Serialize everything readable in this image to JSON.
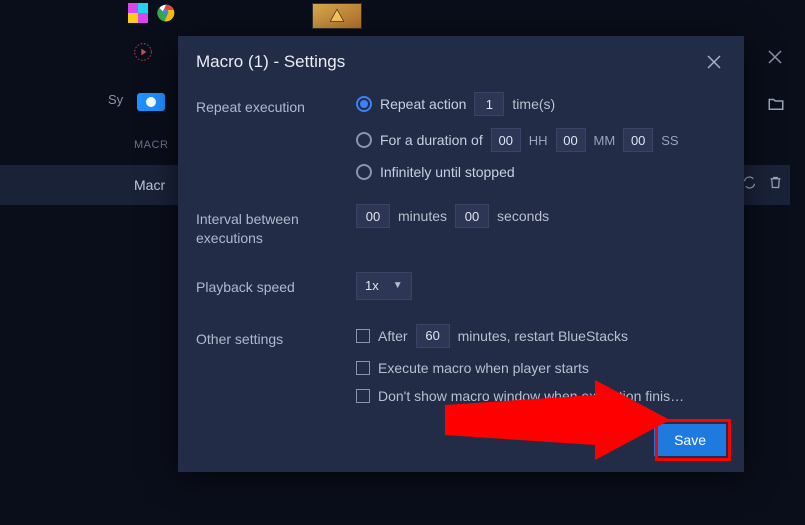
{
  "background": {
    "sy_text": "Sy",
    "macr_label": "MACR",
    "macro_row": "Macr"
  },
  "modal": {
    "title": "Macro (1) - Settings",
    "sections": {
      "repeat": {
        "label": "Repeat execution",
        "opt_repeat_action": "Repeat action",
        "times_value": "1",
        "times_suffix": "time(s)",
        "opt_duration": "For a duration of",
        "hh_val": "00",
        "hh_label": "HH",
        "mm_val": "00",
        "mm_label": "MM",
        "ss_val": "00",
        "ss_label": "SS",
        "opt_infinite": "Infinitely until stopped"
      },
      "interval": {
        "label": "Interval between executions",
        "min_val": "00",
        "min_label": "minutes",
        "sec_val": "00",
        "sec_label": "seconds"
      },
      "playback": {
        "label": "Playback speed",
        "value": "1x"
      },
      "other": {
        "label": "Other settings",
        "after_prefix": "After",
        "after_min": "60",
        "after_suffix": "minutes, restart BlueStacks",
        "execute_on_start": "Execute macro when player starts",
        "dont_show": "Don't show macro window when execution finis…"
      }
    },
    "save_label": "Save"
  }
}
